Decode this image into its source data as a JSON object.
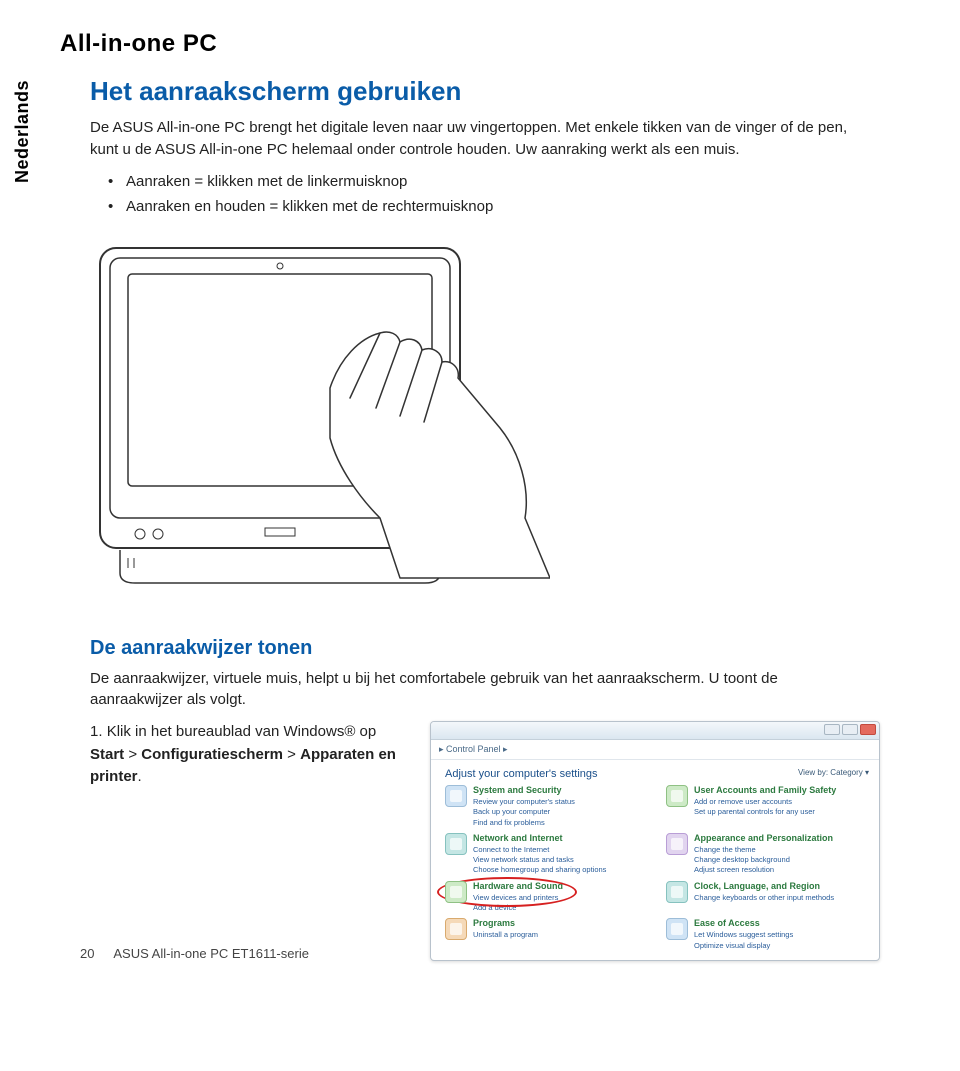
{
  "top_title": "All-in-one PC",
  "side_tab": "Nederlands",
  "section_title": "Het aanraakscherm gebruiken",
  "intro": "De ASUS All-in-one PC brengt het digitale leven naar uw vingertoppen. Met enkele tikken van de vinger of de pen, kunt u de ASUS All-in-one PC helemaal onder controle houden. Uw aanraking werkt als een muis.",
  "bullets": [
    "Aanraken = klikken met de linkermuisknop",
    "Aanraken en houden = klikken met de rechtermuisknop"
  ],
  "sub_title": "De aanraakwijzer tonen",
  "sub_intro": "De aanraakwijzer, virtuele muis, helpt u bij het comfortabele gebruik van het aanraakscherm. U toont de aanraakwijzer als volgt.",
  "step1_num": "1.",
  "step1_pre": "Klik in het bureaublad van Windows® op ",
  "step1_b1": "Start",
  "step1_gt1": " > ",
  "step1_b2": "Configuratiescherm",
  "step1_gt2": " > ",
  "step1_b3": "Apparaten en printer",
  "step1_end": ".",
  "cp": {
    "crumb": "▸ Control Panel ▸",
    "heading": "Adjust your computer's settings",
    "viewby": "View by:  Category ▾",
    "cats": {
      "c1": {
        "title": "System and Security",
        "subs": [
          "Review your computer's status",
          "Back up your computer",
          "Find and fix problems"
        ]
      },
      "c2": {
        "title": "User Accounts and Family Safety",
        "subs": [
          "Add or remove user accounts",
          "Set up parental controls for any user"
        ]
      },
      "c3": {
        "title": "Network and Internet",
        "subs": [
          "Connect to the Internet",
          "View network status and tasks",
          "Choose homegroup and sharing options"
        ]
      },
      "c4": {
        "title": "Appearance and Personalization",
        "subs": [
          "Change the theme",
          "Change desktop background",
          "Adjust screen resolution"
        ]
      },
      "c5": {
        "title": "Hardware and Sound",
        "subs": [
          "View devices and printers",
          "Add a device"
        ]
      },
      "c6": {
        "title": "Clock, Language, and Region",
        "subs": [
          "Change keyboards or other input methods"
        ]
      },
      "c7": {
        "title": "Programs",
        "subs": [
          "Uninstall a program"
        ]
      },
      "c8": {
        "title": "Ease of Access",
        "subs": [
          "Let Windows suggest settings",
          "Optimize visual display"
        ]
      }
    }
  },
  "footer_page": "20",
  "footer_text": "ASUS All-in-one PC ET1611-serie"
}
